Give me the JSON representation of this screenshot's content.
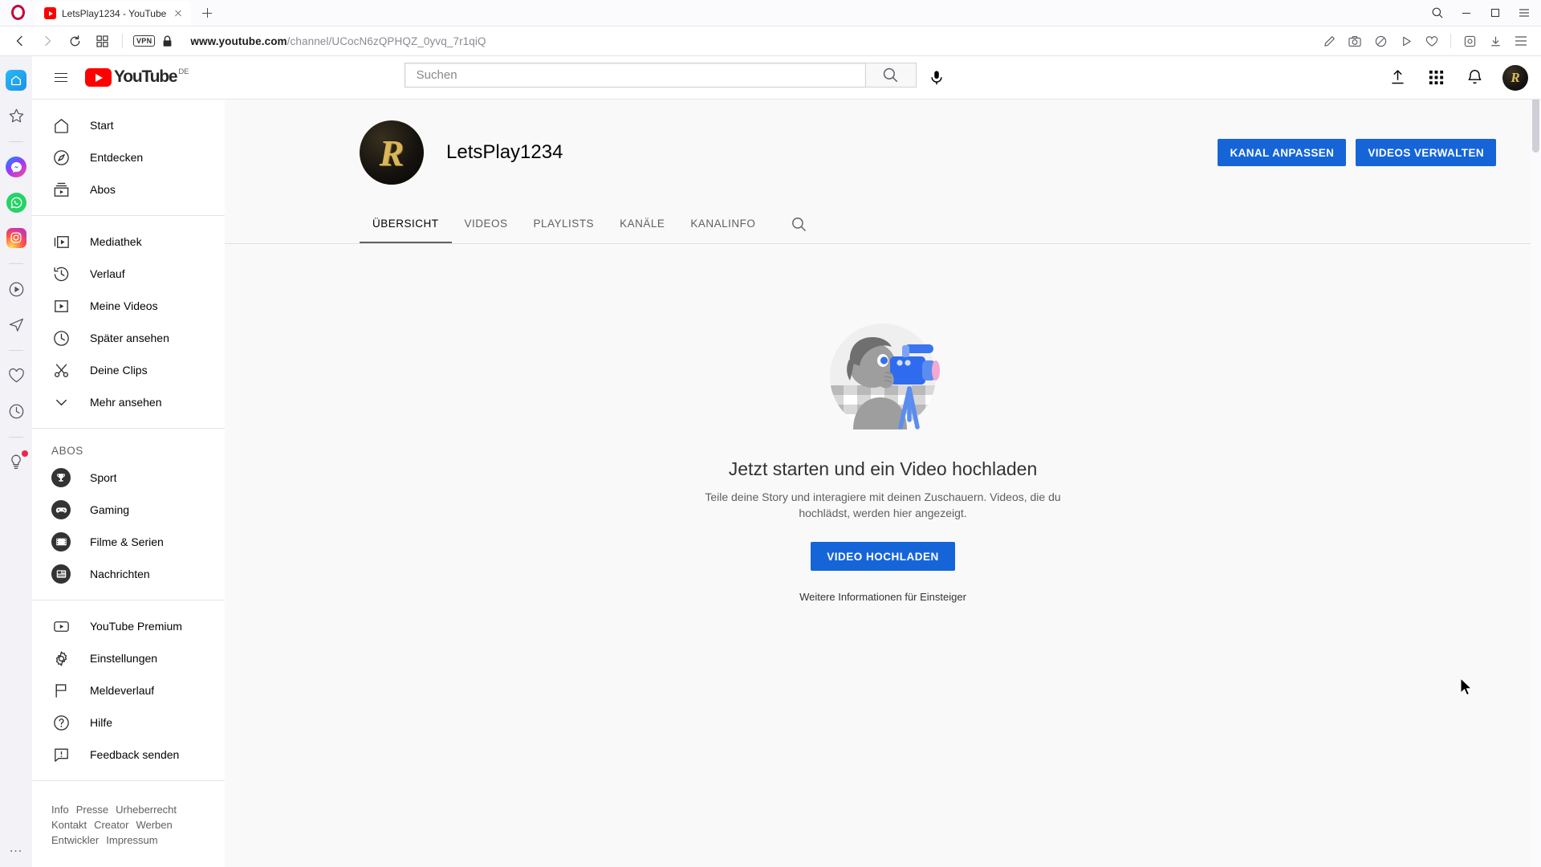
{
  "browser": {
    "name": "Opera",
    "tab": {
      "title": "LetsPlay1234 - YouTube",
      "favicon": "youtube-icon"
    },
    "new_tab_label": "+",
    "url": {
      "domain": "www.youtube.com",
      "path": "/channel/UCocN6zQPHQZ_0yvq_7r1qiQ"
    },
    "vpn_badge": "VPN",
    "nav_icons": [
      "back-icon",
      "forward-icon",
      "reload-icon",
      "tab-grid-icon"
    ],
    "address_right_icons": [
      "edit-icon",
      "screenshot-icon",
      "block-ads-icon",
      "player-icon",
      "heart-icon",
      "extensions-icon",
      "download-icon",
      "menu-icon"
    ],
    "window_controls": [
      "search-icon",
      "minimize-icon",
      "maximize-icon",
      "close-icon"
    ],
    "sidebar": [
      {
        "name": "home-icon",
        "active": true
      },
      {
        "name": "star-icon",
        "active": false
      },
      {
        "name": "divider",
        "active": false
      },
      {
        "name": "messenger-icon",
        "active": false
      },
      {
        "name": "whatsapp-icon",
        "active": false
      },
      {
        "name": "instagram-icon",
        "active": false
      },
      {
        "name": "divider",
        "active": false
      },
      {
        "name": "player-icon",
        "active": false
      },
      {
        "name": "telegram-icon",
        "active": false
      },
      {
        "name": "divider",
        "active": false
      },
      {
        "name": "heart-icon",
        "active": false
      },
      {
        "name": "history-clock-icon",
        "active": false
      },
      {
        "name": "divider",
        "active": false
      },
      {
        "name": "tips-bulb-icon",
        "active": false,
        "badge": true
      }
    ],
    "sidebar_more": "…"
  },
  "youtube": {
    "header": {
      "menu_icon": "hamburger-icon",
      "logo_text": "YouTube",
      "country_code": "DE",
      "search_placeholder": "Suchen",
      "search_value": "",
      "search_button_icon": "search-icon",
      "mic_icon": "microphone-icon",
      "upload_icon": "upload-icon",
      "apps_icon": "apps-grid-icon",
      "notifications_icon": "bell-icon",
      "avatar_letter": "R"
    },
    "guide": {
      "primary": [
        {
          "icon": "home-icon",
          "label": "Start"
        },
        {
          "icon": "compass-icon",
          "label": "Entdecken"
        },
        {
          "icon": "subs-icon",
          "label": "Abos"
        }
      ],
      "library": [
        {
          "icon": "library-icon",
          "label": "Mediathek"
        },
        {
          "icon": "history-icon",
          "label": "Verlauf"
        },
        {
          "icon": "my-videos-icon",
          "label": "Meine Videos"
        },
        {
          "icon": "watch-later-icon",
          "label": "Später ansehen"
        },
        {
          "icon": "scissors-icon",
          "label": "Deine Clips"
        },
        {
          "icon": "chevron-down-icon",
          "label": "Mehr ansehen"
        }
      ],
      "subs_heading": "Abos",
      "subscriptions": [
        {
          "icon": "trophy-icon",
          "label": "Sport"
        },
        {
          "icon": "gamepad-icon",
          "label": "Gaming"
        },
        {
          "icon": "film-icon",
          "label": "Filme & Serien"
        },
        {
          "icon": "newspaper-icon",
          "label": "Nachrichten"
        }
      ],
      "settings": [
        {
          "icon": "yt-premium-icon",
          "label": "YouTube Premium"
        },
        {
          "icon": "gear-icon",
          "label": "Einstellungen"
        },
        {
          "icon": "flag-icon",
          "label": "Meldeverlauf"
        },
        {
          "icon": "help-icon",
          "label": "Hilfe"
        },
        {
          "icon": "feedback-icon",
          "label": "Feedback senden"
        }
      ],
      "footer_links": [
        "Info",
        "Presse",
        "Urheberrecht",
        "Kontakt",
        "Creator",
        "Werben",
        "Entwickler",
        "Impressum"
      ]
    },
    "channel": {
      "avatar_letter": "R",
      "name": "LetsPlay1234",
      "customize_button": "KANAL ANPASSEN",
      "manage_videos_button": "VIDEOS VERWALTEN",
      "tabs": [
        {
          "label": "ÜBERSICHT",
          "active": true
        },
        {
          "label": "VIDEOS",
          "active": false
        },
        {
          "label": "PLAYLISTS",
          "active": false
        },
        {
          "label": "KANÄLE",
          "active": false
        },
        {
          "label": "KANALINFO",
          "active": false
        }
      ],
      "tab_search_icon": "search-icon",
      "empty_state": {
        "illustration": "person-filming-illustration",
        "title": "Jetzt starten und ein Video hochladen",
        "subtitle": "Teile deine Story und interagiere mit deinen Zuschauern. Videos, die du hochlädst, werden hier angezeigt.",
        "upload_button": "VIDEO HOCHLADEN",
        "help_link": "Weitere Informationen für Einsteiger"
      }
    }
  },
  "colors": {
    "accent_blue": "#1565d8",
    "youtube_red": "#ff0000",
    "page_bg": "#f9f9f9",
    "opera_red": "#c4063a",
    "gold": "#d9b65a"
  }
}
